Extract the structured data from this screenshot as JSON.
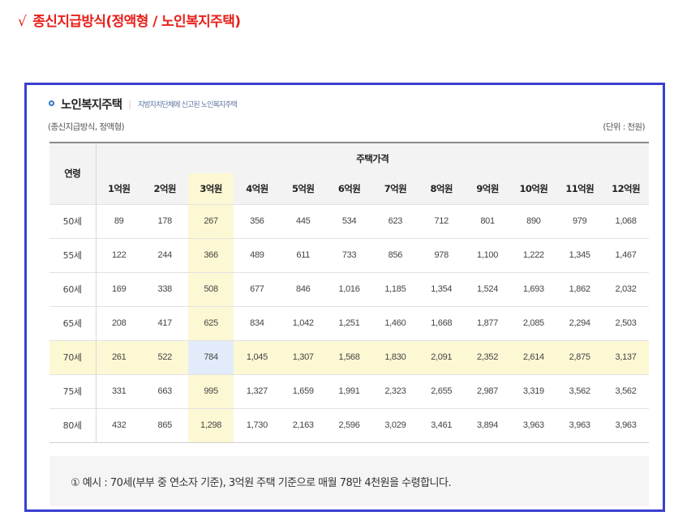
{
  "heading": {
    "check_mark": "√",
    "text": "종신지급방식(정액형 / 노인복지주택)"
  },
  "card": {
    "title": "노인복지주택",
    "separator": "|",
    "subtitle": "지방자치단체에 신고된 노인복지주택"
  },
  "meta": {
    "left": "(종신지급방식, 정액형)",
    "right": "(단위 : 천원)"
  },
  "table": {
    "age_header": "연령",
    "group_header": "주택가격",
    "columns": [
      "1억원",
      "2억원",
      "3억원",
      "4억원",
      "5억원",
      "6억원",
      "7억원",
      "8억원",
      "9억원",
      "10억원",
      "11억원",
      "12억원"
    ],
    "highlight_column_index": 2,
    "highlight_row_index": 4,
    "rows": [
      {
        "age": "50세",
        "values": [
          "89",
          "178",
          "267",
          "356",
          "445",
          "534",
          "623",
          "712",
          "801",
          "890",
          "979",
          "1,068"
        ]
      },
      {
        "age": "55세",
        "values": [
          "122",
          "244",
          "366",
          "489",
          "611",
          "733",
          "856",
          "978",
          "1,100",
          "1,222",
          "1,345",
          "1,467"
        ]
      },
      {
        "age": "60세",
        "values": [
          "169",
          "338",
          "508",
          "677",
          "846",
          "1,016",
          "1,185",
          "1,354",
          "1,524",
          "1,693",
          "1,862",
          "2,032"
        ]
      },
      {
        "age": "65세",
        "values": [
          "208",
          "417",
          "625",
          "834",
          "1,042",
          "1,251",
          "1,460",
          "1,668",
          "1,877",
          "2,085",
          "2,294",
          "2,503"
        ]
      },
      {
        "age": "70세",
        "values": [
          "261",
          "522",
          "784",
          "1,045",
          "1,307",
          "1,568",
          "1,830",
          "2,091",
          "2,352",
          "2,614",
          "2,875",
          "3,137"
        ]
      },
      {
        "age": "75세",
        "values": [
          "331",
          "663",
          "995",
          "1,327",
          "1,659",
          "1,991",
          "2,323",
          "2,655",
          "2,987",
          "3,319",
          "3,562",
          "3,562"
        ]
      },
      {
        "age": "80세",
        "values": [
          "432",
          "865",
          "1,298",
          "1,730",
          "2,163",
          "2,596",
          "3,029",
          "3,461",
          "3,894",
          "3,963",
          "3,963",
          "3,963"
        ]
      }
    ]
  },
  "note": {
    "text": "① 예시 : 70세(부부 중 연소자 기준), 3억원 주택 기준으로 매월 78만 4천원을 수령합니다."
  },
  "colors": {
    "heading": "#e8201b",
    "frame_border": "#3a3fd0",
    "highlight": "#fdf8d4",
    "cross_highlight": "#e2ebfa",
    "bullet": "#2a79c6"
  }
}
